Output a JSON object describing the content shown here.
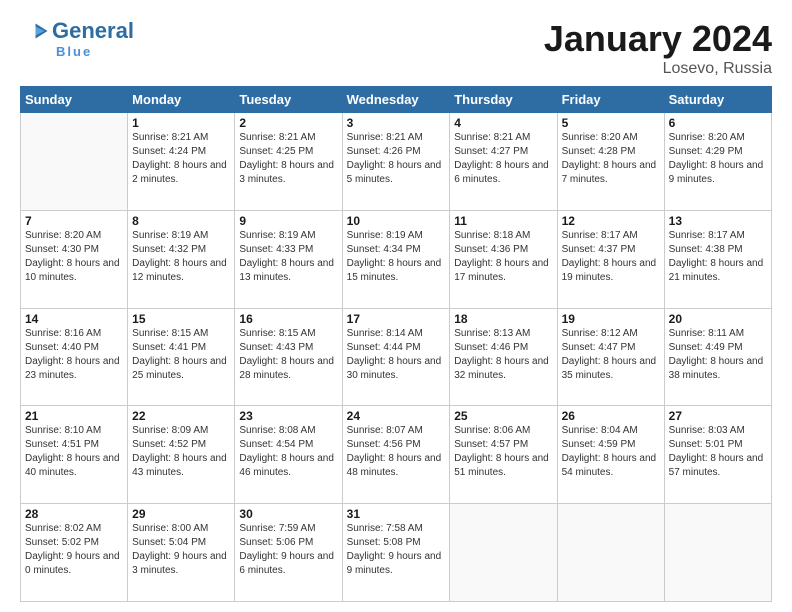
{
  "header": {
    "logo_line1": "General",
    "logo_line2": "Blue",
    "logo_sub": "Blue",
    "month_title": "January 2024",
    "location": "Losevo, Russia"
  },
  "days_of_week": [
    "Sunday",
    "Monday",
    "Tuesday",
    "Wednesday",
    "Thursday",
    "Friday",
    "Saturday"
  ],
  "weeks": [
    [
      {
        "num": "",
        "sunrise": "",
        "sunset": "",
        "daylight": ""
      },
      {
        "num": "1",
        "sunrise": "Sunrise: 8:21 AM",
        "sunset": "Sunset: 4:24 PM",
        "daylight": "Daylight: 8 hours and 2 minutes."
      },
      {
        "num": "2",
        "sunrise": "Sunrise: 8:21 AM",
        "sunset": "Sunset: 4:25 PM",
        "daylight": "Daylight: 8 hours and 3 minutes."
      },
      {
        "num": "3",
        "sunrise": "Sunrise: 8:21 AM",
        "sunset": "Sunset: 4:26 PM",
        "daylight": "Daylight: 8 hours and 5 minutes."
      },
      {
        "num": "4",
        "sunrise": "Sunrise: 8:21 AM",
        "sunset": "Sunset: 4:27 PM",
        "daylight": "Daylight: 8 hours and 6 minutes."
      },
      {
        "num": "5",
        "sunrise": "Sunrise: 8:20 AM",
        "sunset": "Sunset: 4:28 PM",
        "daylight": "Daylight: 8 hours and 7 minutes."
      },
      {
        "num": "6",
        "sunrise": "Sunrise: 8:20 AM",
        "sunset": "Sunset: 4:29 PM",
        "daylight": "Daylight: 8 hours and 9 minutes."
      }
    ],
    [
      {
        "num": "7",
        "sunrise": "Sunrise: 8:20 AM",
        "sunset": "Sunset: 4:30 PM",
        "daylight": "Daylight: 8 hours and 10 minutes."
      },
      {
        "num": "8",
        "sunrise": "Sunrise: 8:19 AM",
        "sunset": "Sunset: 4:32 PM",
        "daylight": "Daylight: 8 hours and 12 minutes."
      },
      {
        "num": "9",
        "sunrise": "Sunrise: 8:19 AM",
        "sunset": "Sunset: 4:33 PM",
        "daylight": "Daylight: 8 hours and 13 minutes."
      },
      {
        "num": "10",
        "sunrise": "Sunrise: 8:19 AM",
        "sunset": "Sunset: 4:34 PM",
        "daylight": "Daylight: 8 hours and 15 minutes."
      },
      {
        "num": "11",
        "sunrise": "Sunrise: 8:18 AM",
        "sunset": "Sunset: 4:36 PM",
        "daylight": "Daylight: 8 hours and 17 minutes."
      },
      {
        "num": "12",
        "sunrise": "Sunrise: 8:17 AM",
        "sunset": "Sunset: 4:37 PM",
        "daylight": "Daylight: 8 hours and 19 minutes."
      },
      {
        "num": "13",
        "sunrise": "Sunrise: 8:17 AM",
        "sunset": "Sunset: 4:38 PM",
        "daylight": "Daylight: 8 hours and 21 minutes."
      }
    ],
    [
      {
        "num": "14",
        "sunrise": "Sunrise: 8:16 AM",
        "sunset": "Sunset: 4:40 PM",
        "daylight": "Daylight: 8 hours and 23 minutes."
      },
      {
        "num": "15",
        "sunrise": "Sunrise: 8:15 AM",
        "sunset": "Sunset: 4:41 PM",
        "daylight": "Daylight: 8 hours and 25 minutes."
      },
      {
        "num": "16",
        "sunrise": "Sunrise: 8:15 AM",
        "sunset": "Sunset: 4:43 PM",
        "daylight": "Daylight: 8 hours and 28 minutes."
      },
      {
        "num": "17",
        "sunrise": "Sunrise: 8:14 AM",
        "sunset": "Sunset: 4:44 PM",
        "daylight": "Daylight: 8 hours and 30 minutes."
      },
      {
        "num": "18",
        "sunrise": "Sunrise: 8:13 AM",
        "sunset": "Sunset: 4:46 PM",
        "daylight": "Daylight: 8 hours and 32 minutes."
      },
      {
        "num": "19",
        "sunrise": "Sunrise: 8:12 AM",
        "sunset": "Sunset: 4:47 PM",
        "daylight": "Daylight: 8 hours and 35 minutes."
      },
      {
        "num": "20",
        "sunrise": "Sunrise: 8:11 AM",
        "sunset": "Sunset: 4:49 PM",
        "daylight": "Daylight: 8 hours and 38 minutes."
      }
    ],
    [
      {
        "num": "21",
        "sunrise": "Sunrise: 8:10 AM",
        "sunset": "Sunset: 4:51 PM",
        "daylight": "Daylight: 8 hours and 40 minutes."
      },
      {
        "num": "22",
        "sunrise": "Sunrise: 8:09 AM",
        "sunset": "Sunset: 4:52 PM",
        "daylight": "Daylight: 8 hours and 43 minutes."
      },
      {
        "num": "23",
        "sunrise": "Sunrise: 8:08 AM",
        "sunset": "Sunset: 4:54 PM",
        "daylight": "Daylight: 8 hours and 46 minutes."
      },
      {
        "num": "24",
        "sunrise": "Sunrise: 8:07 AM",
        "sunset": "Sunset: 4:56 PM",
        "daylight": "Daylight: 8 hours and 48 minutes."
      },
      {
        "num": "25",
        "sunrise": "Sunrise: 8:06 AM",
        "sunset": "Sunset: 4:57 PM",
        "daylight": "Daylight: 8 hours and 51 minutes."
      },
      {
        "num": "26",
        "sunrise": "Sunrise: 8:04 AM",
        "sunset": "Sunset: 4:59 PM",
        "daylight": "Daylight: 8 hours and 54 minutes."
      },
      {
        "num": "27",
        "sunrise": "Sunrise: 8:03 AM",
        "sunset": "Sunset: 5:01 PM",
        "daylight": "Daylight: 8 hours and 57 minutes."
      }
    ],
    [
      {
        "num": "28",
        "sunrise": "Sunrise: 8:02 AM",
        "sunset": "Sunset: 5:02 PM",
        "daylight": "Daylight: 9 hours and 0 minutes."
      },
      {
        "num": "29",
        "sunrise": "Sunrise: 8:00 AM",
        "sunset": "Sunset: 5:04 PM",
        "daylight": "Daylight: 9 hours and 3 minutes."
      },
      {
        "num": "30",
        "sunrise": "Sunrise: 7:59 AM",
        "sunset": "Sunset: 5:06 PM",
        "daylight": "Daylight: 9 hours and 6 minutes."
      },
      {
        "num": "31",
        "sunrise": "Sunrise: 7:58 AM",
        "sunset": "Sunset: 5:08 PM",
        "daylight": "Daylight: 9 hours and 9 minutes."
      },
      {
        "num": "",
        "sunrise": "",
        "sunset": "",
        "daylight": ""
      },
      {
        "num": "",
        "sunrise": "",
        "sunset": "",
        "daylight": ""
      },
      {
        "num": "",
        "sunrise": "",
        "sunset": "",
        "daylight": ""
      }
    ]
  ]
}
